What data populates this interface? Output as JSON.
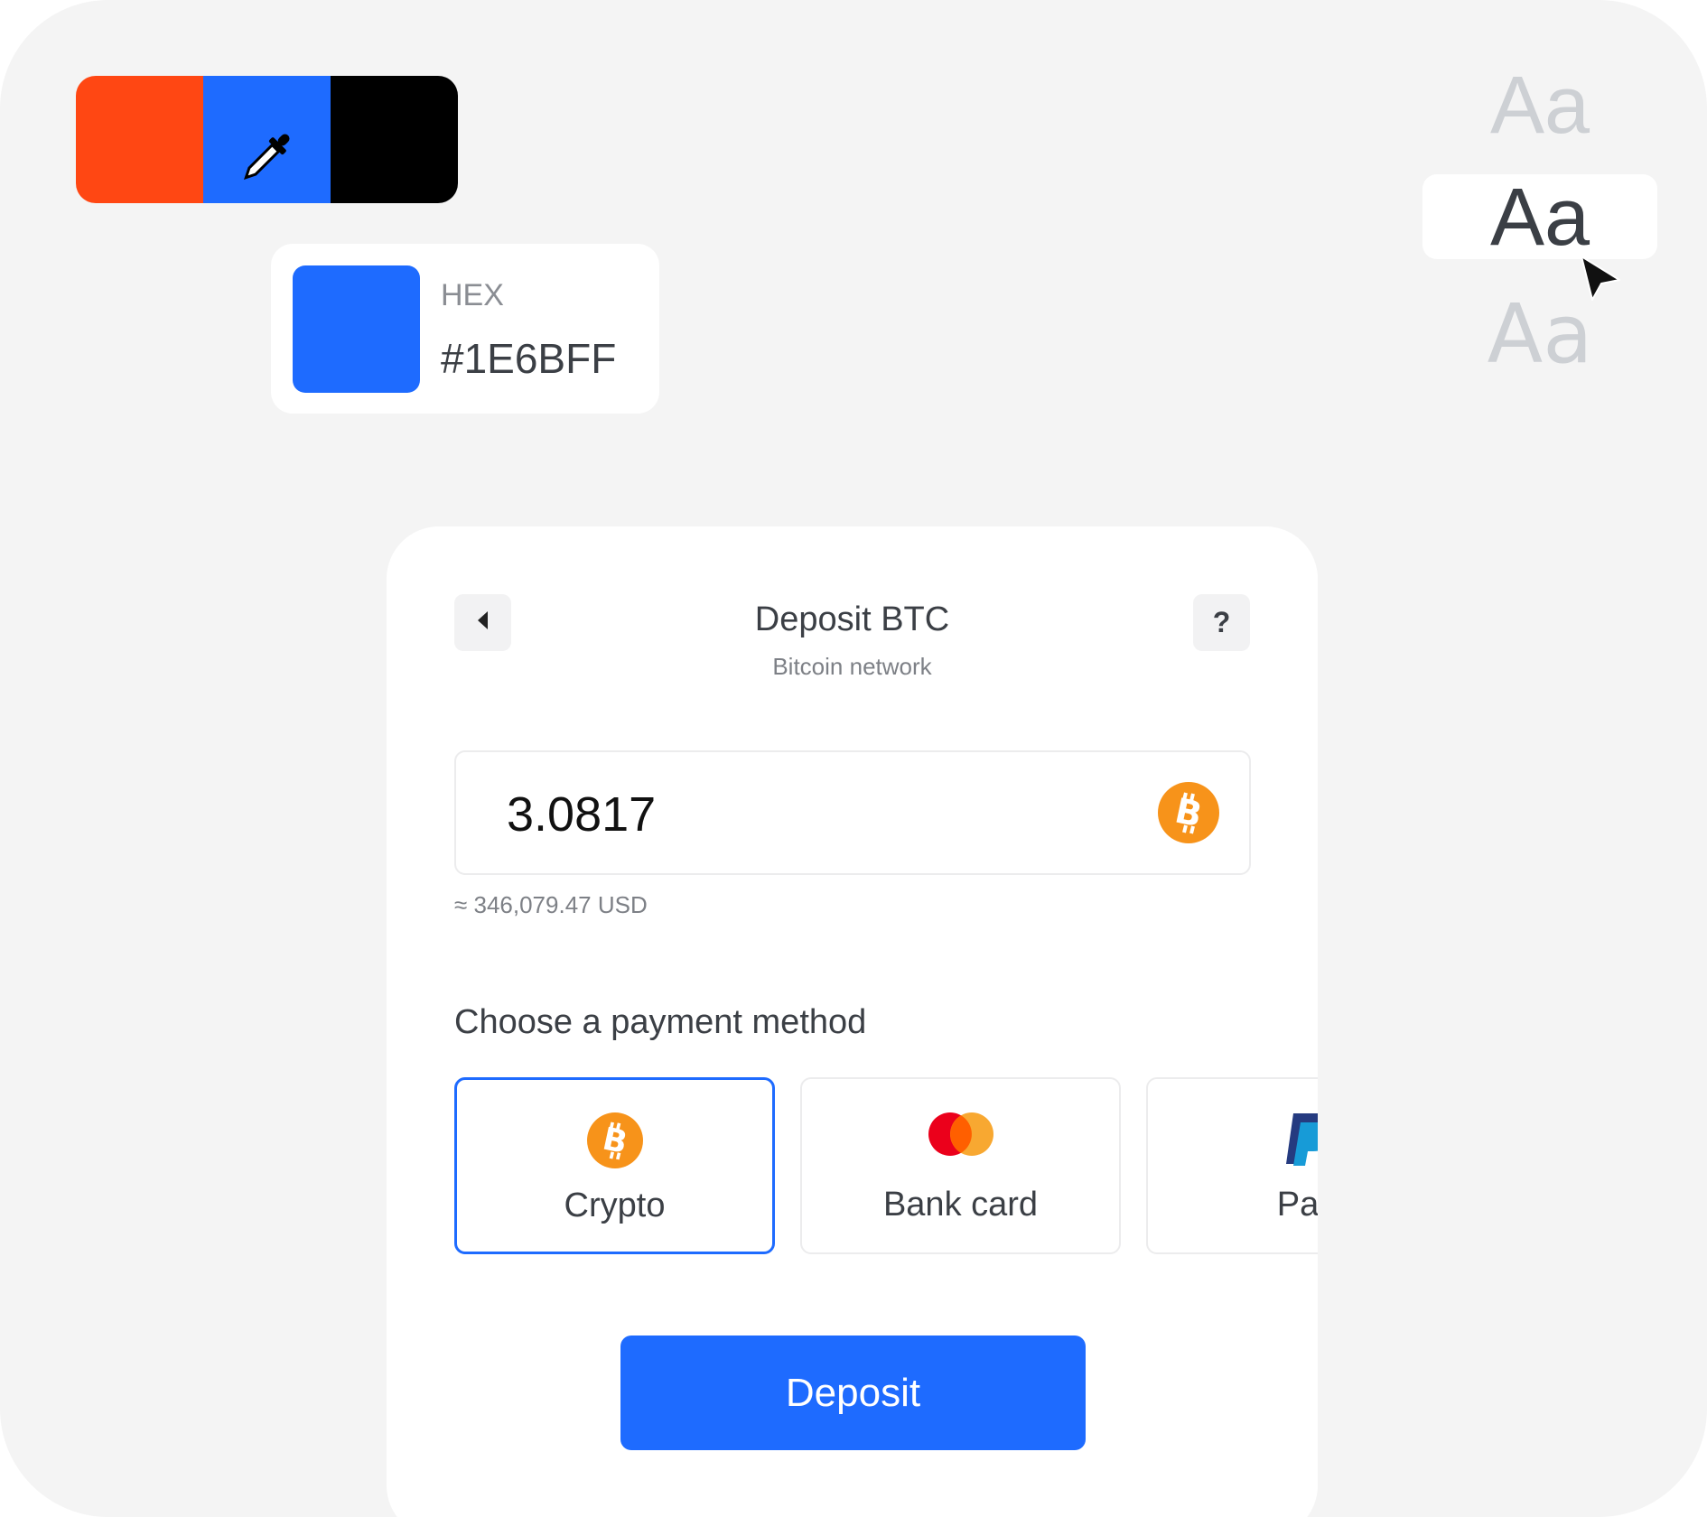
{
  "palette": {
    "swatches": [
      "#ff4713",
      "#1e6bff",
      "#000000"
    ],
    "picker_icon": "eyedropper-icon"
  },
  "color_card": {
    "label": "HEX",
    "value": "#1E6BFF",
    "color": "#1E6BFF"
  },
  "font_options": {
    "items": [
      "Aa",
      "Aa",
      "Aa"
    ],
    "selected_index": 1,
    "cursor_icon": "pointer-cursor-icon"
  },
  "deposit": {
    "title": "Deposit BTC",
    "subtitle": "Bitcoin network",
    "back_icon": "chevron-left-icon",
    "help_label": "?",
    "amount": "3.0817",
    "amount_icon": "bitcoin-icon",
    "usd_equivalent": "≈ 346,079.47 USD",
    "payment_title": "Choose a payment method",
    "payment_methods": [
      {
        "label": "Crypto",
        "icon": "bitcoin-icon",
        "selected": true
      },
      {
        "label": "Bank card",
        "icon": "mastercard-icon",
        "selected": false
      },
      {
        "label": "Pay",
        "icon": "paypal-icon",
        "selected": false
      }
    ],
    "submit_label": "Deposit"
  },
  "colors": {
    "accent": "#1E6BFF",
    "bitcoin": "#F7931A",
    "mastercard_red": "#EB001B",
    "mastercard_orange": "#F79E1B"
  }
}
